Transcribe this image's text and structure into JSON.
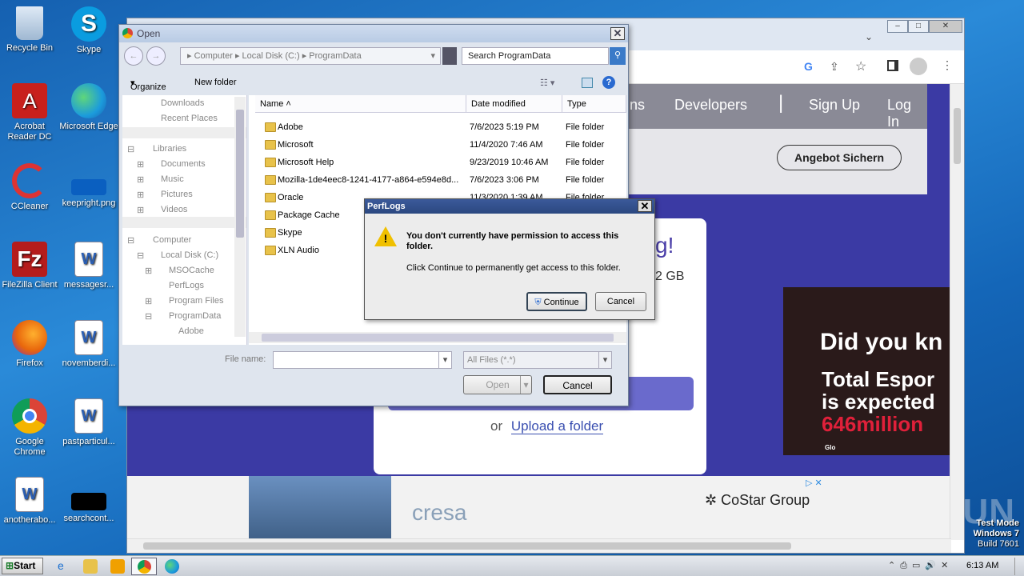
{
  "desktop": {
    "icons": [
      {
        "label": "Recycle Bin",
        "icon": "recycle-bin-icon",
        "color": "#bcd6ee"
      },
      {
        "label": "Skype",
        "icon": "skype-icon",
        "color": "#0a9ce0"
      },
      {
        "label": "Acrobat Reader DC",
        "icon": "acrobat-icon",
        "color": "#c8201c"
      },
      {
        "label": "Microsoft Edge",
        "icon": "edge-icon",
        "color": "#1b9bdc"
      },
      {
        "label": "CCleaner",
        "icon": "ccleaner-icon",
        "color": "#d33"
      },
      {
        "label": "keepright.png",
        "icon": "image-file-icon",
        "color": "#0a5fc0"
      },
      {
        "label": "FileZilla Client",
        "icon": "filezilla-icon",
        "color": "#b51c1c"
      },
      {
        "label": "messagesr...",
        "icon": "word-doc-icon",
        "color": "#fff"
      },
      {
        "label": "Firefox",
        "icon": "firefox-icon",
        "color": "#e8660c"
      },
      {
        "label": "novemberdi...",
        "icon": "word-doc-icon",
        "color": "#fff"
      },
      {
        "label": "Google Chrome",
        "icon": "chrome-icon",
        "color": "#4a9c3a"
      },
      {
        "label": "pastparticul...",
        "icon": "word-doc-icon",
        "color": "#fff"
      },
      {
        "label": "anotherabo...",
        "icon": "word-doc-icon",
        "color": "#fff"
      },
      {
        "label": "searchcont...",
        "icon": "black-file-icon",
        "color": "#000"
      }
    ],
    "watermark": {
      "brand": "ANY▷RUN",
      "line1": "Test Mode",
      "line2": "Windows 7",
      "line3": "Build 7601"
    }
  },
  "browser": {
    "nav": {
      "item1": "ns",
      "item2": "Developers",
      "item3": "Sign Up",
      "item4": "Log In"
    },
    "hero_button": "Angebot Sichern",
    "card": {
      "headline_tail": "g!",
      "size_tail": "2 GB",
      "or": "or",
      "upload_folder": "Upload a folder"
    },
    "ad_right": {
      "line1": "Did you kn",
      "line2": "Total Espor",
      "line3": "is expected",
      "line4": "646million",
      "brand": "Glo"
    },
    "ad_bottom": {
      "brand1": "cresa",
      "brand2": "CoStar Group"
    }
  },
  "open_dialog": {
    "title": "Open",
    "breadcrumb": [
      "Computer",
      "Local Disk (C:)",
      "ProgramData"
    ],
    "search_placeholder": "Search ProgramData",
    "organize": "Organize",
    "new_folder": "New folder",
    "nav_items": [
      {
        "label": "Downloads",
        "indent": 1
      },
      {
        "label": "Recent Places",
        "indent": 1
      },
      {
        "label": "Libraries",
        "indent": 0
      },
      {
        "label": "Documents",
        "indent": 1
      },
      {
        "label": "Music",
        "indent": 1
      },
      {
        "label": "Pictures",
        "indent": 1
      },
      {
        "label": "Videos",
        "indent": 1
      },
      {
        "label": "Computer",
        "indent": 0
      },
      {
        "label": "Local Disk (C:)",
        "indent": 1
      },
      {
        "label": "MSOCache",
        "indent": 2
      },
      {
        "label": "PerfLogs",
        "indent": 2
      },
      {
        "label": "Program Files",
        "indent": 2
      },
      {
        "label": "ProgramData",
        "indent": 2
      },
      {
        "label": "Adobe",
        "indent": 3
      }
    ],
    "columns": {
      "name": "Name",
      "date": "Date modified",
      "type": "Type"
    },
    "files": [
      {
        "name": "Adobe",
        "date": "7/6/2023 5:19 PM",
        "type": "File folder"
      },
      {
        "name": "Microsoft",
        "date": "11/4/2020 7:46 AM",
        "type": "File folder"
      },
      {
        "name": "Microsoft Help",
        "date": "9/23/2019 10:46 AM",
        "type": "File folder"
      },
      {
        "name": "Mozilla-1de4eec8-1241-4177-a864-e594e8d...",
        "date": "7/6/2023 3:06 PM",
        "type": "File folder"
      },
      {
        "name": "Oracle",
        "date": "11/3/2020 1:39 AM",
        "type": "File folder"
      },
      {
        "name": "Package Cache",
        "date": "",
        "type": ""
      },
      {
        "name": "Skype",
        "date": "",
        "type": ""
      },
      {
        "name": "XLN Audio",
        "date": "",
        "type": ""
      }
    ],
    "filename_label": "File name:",
    "filename_value": "",
    "filetype": "All Files (*.*)",
    "open_button": "Open",
    "cancel_button": "Cancel"
  },
  "perm_dialog": {
    "title": "PerfLogs",
    "heading": "You don't currently have permission to access this folder.",
    "body": "Click Continue to permanently get access to this folder.",
    "continue_button": "Continue",
    "cancel_button": "Cancel"
  },
  "taskbar": {
    "start": "Start",
    "clock": "6:13 AM"
  }
}
